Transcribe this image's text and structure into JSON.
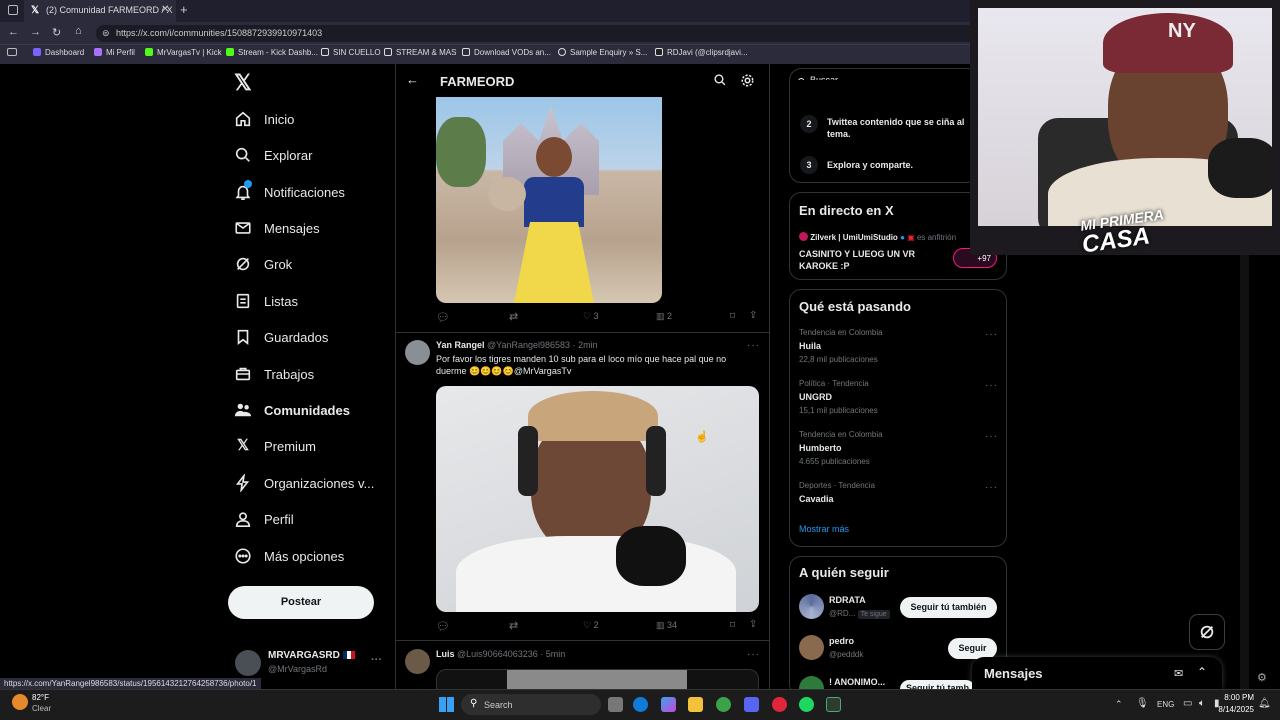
{
  "browser": {
    "tab_title": "(2) Comunidad FARMEORD / X",
    "url": "https://x.com/i/communities/1508872939910971403",
    "bookmarks": [
      "Dashboard",
      "Mi Perfil",
      "MrVargasTv | Kick",
      "Stream - Kick Dashb...",
      "SIN CUELLO",
      "STREAM & MAS",
      "Download VODs an...",
      "Sample Enquiry » S...",
      "RDJavi (@clipsrdjavi..."
    ]
  },
  "nav": {
    "items": [
      "Inicio",
      "Explorar",
      "Notificaciones",
      "Mensajes",
      "Grok",
      "Listas",
      "Guardados",
      "Trabajos",
      "Comunidades",
      "Premium",
      "Organizaciones v...",
      "Perfil",
      "Más opciones"
    ],
    "post_label": "Postear",
    "account_name": "MRVARGASRD",
    "account_handle": "@MrVargasRd"
  },
  "community": {
    "title": "FARMEORD"
  },
  "tweets": [
    {
      "stats": {
        "likes": "3",
        "views": "2"
      }
    },
    {
      "author": "Yan Rangel",
      "handle": "@YanRangel986583",
      "time": "· 2min",
      "text": "Por favor los tigres manden 10 sub para el loco mío que hace pal que no duerme 😊😊😊😊@MrVargasTv",
      "stats": {
        "likes": "2",
        "views": "34"
      }
    },
    {
      "author": "Luis",
      "handle": "@Luis90664063236",
      "time": "· 5min"
    }
  ],
  "search": {
    "placeholder": "Buscar"
  },
  "steps": [
    {
      "n": "2",
      "text": "Twittea contenido que se ciña al tema."
    },
    {
      "n": "3",
      "text": "Explora y comparte."
    }
  ],
  "live": {
    "title": "En directo en X",
    "host": "Zilverk | UmiUmiStudio",
    "host_suffix": "es anfitrión",
    "text": "CASINITO Y LUEOG UN VR KAROKE :P",
    "count": "+97"
  },
  "trends": {
    "title": "Qué está pasando",
    "items": [
      {
        "context": "Tendencia en Colombia",
        "name": "Huila",
        "posts": "22,8 mil publicaciones"
      },
      {
        "context": "Política · Tendencia",
        "name": "UNGRD",
        "posts": "15,1 mil publicaciones"
      },
      {
        "context": "Tendencia en Colombia",
        "name": "Humberto",
        "posts": "4.655 publicaciones"
      },
      {
        "context": "Deportes · Tendencia",
        "name": "Cavadia",
        "posts": ""
      }
    ],
    "more": "Mostrar más"
  },
  "follow": {
    "title": "A quién seguir",
    "items": [
      {
        "name": "RDRATA",
        "handle": "@RD...",
        "badge": "Te sigue",
        "button": "Seguir tú también"
      },
      {
        "name": "pedro",
        "handle": "@pedddk",
        "button": "Seguir"
      },
      {
        "name": "! ANONIMO...",
        "button": "Seguir tú tamb"
      }
    ]
  },
  "messages": {
    "title": "Mensajes"
  },
  "statusbar": {
    "link": "https://x.com/YanRangel986583/status/1956143212764258736/photo/1"
  },
  "webcam": {
    "overlay_line1": "MI PRIMERA",
    "overlay_line2": "CASA"
  },
  "taskbar": {
    "weather_temp": "82°F",
    "weather_desc": "Clear",
    "search": "Search",
    "lang": "ENG",
    "time": "8:00 PM",
    "date": "8/14/2025"
  },
  "colors": {
    "accent": "#1d9bf0",
    "bg": "#000000",
    "border": "#2f3336",
    "muted": "#71767b"
  }
}
